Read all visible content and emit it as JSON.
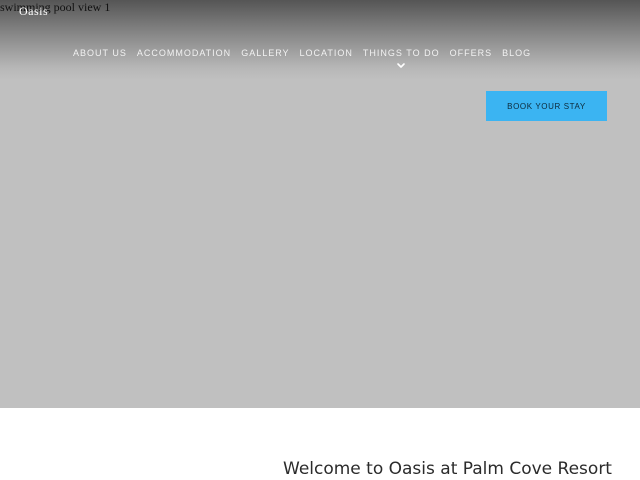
{
  "hero": {
    "image_alt": "swimming pool view 1"
  },
  "header": {
    "logo_text": "Oasis",
    "nav": [
      {
        "label": "ABOUT US"
      },
      {
        "label": "ACCOMMODATION"
      },
      {
        "label": "GALLERY"
      },
      {
        "label": "LOCATION"
      },
      {
        "label": "THINGS TO DO",
        "has_dropdown": true
      },
      {
        "label": "OFFERS"
      },
      {
        "label": "BLOG"
      }
    ],
    "cta_label": "BOOK YOUR STAY"
  },
  "intro": {
    "heading": "Welcome to Oasis at Palm Cove Resort"
  },
  "colors": {
    "hero_placeholder": "#c0c0c0",
    "cta_background": "#3bb4f2",
    "nav_text": "#f2f2f2",
    "heading_text": "#2b2b2b"
  },
  "icons": {
    "dropdown": "chevron-down-icon"
  }
}
